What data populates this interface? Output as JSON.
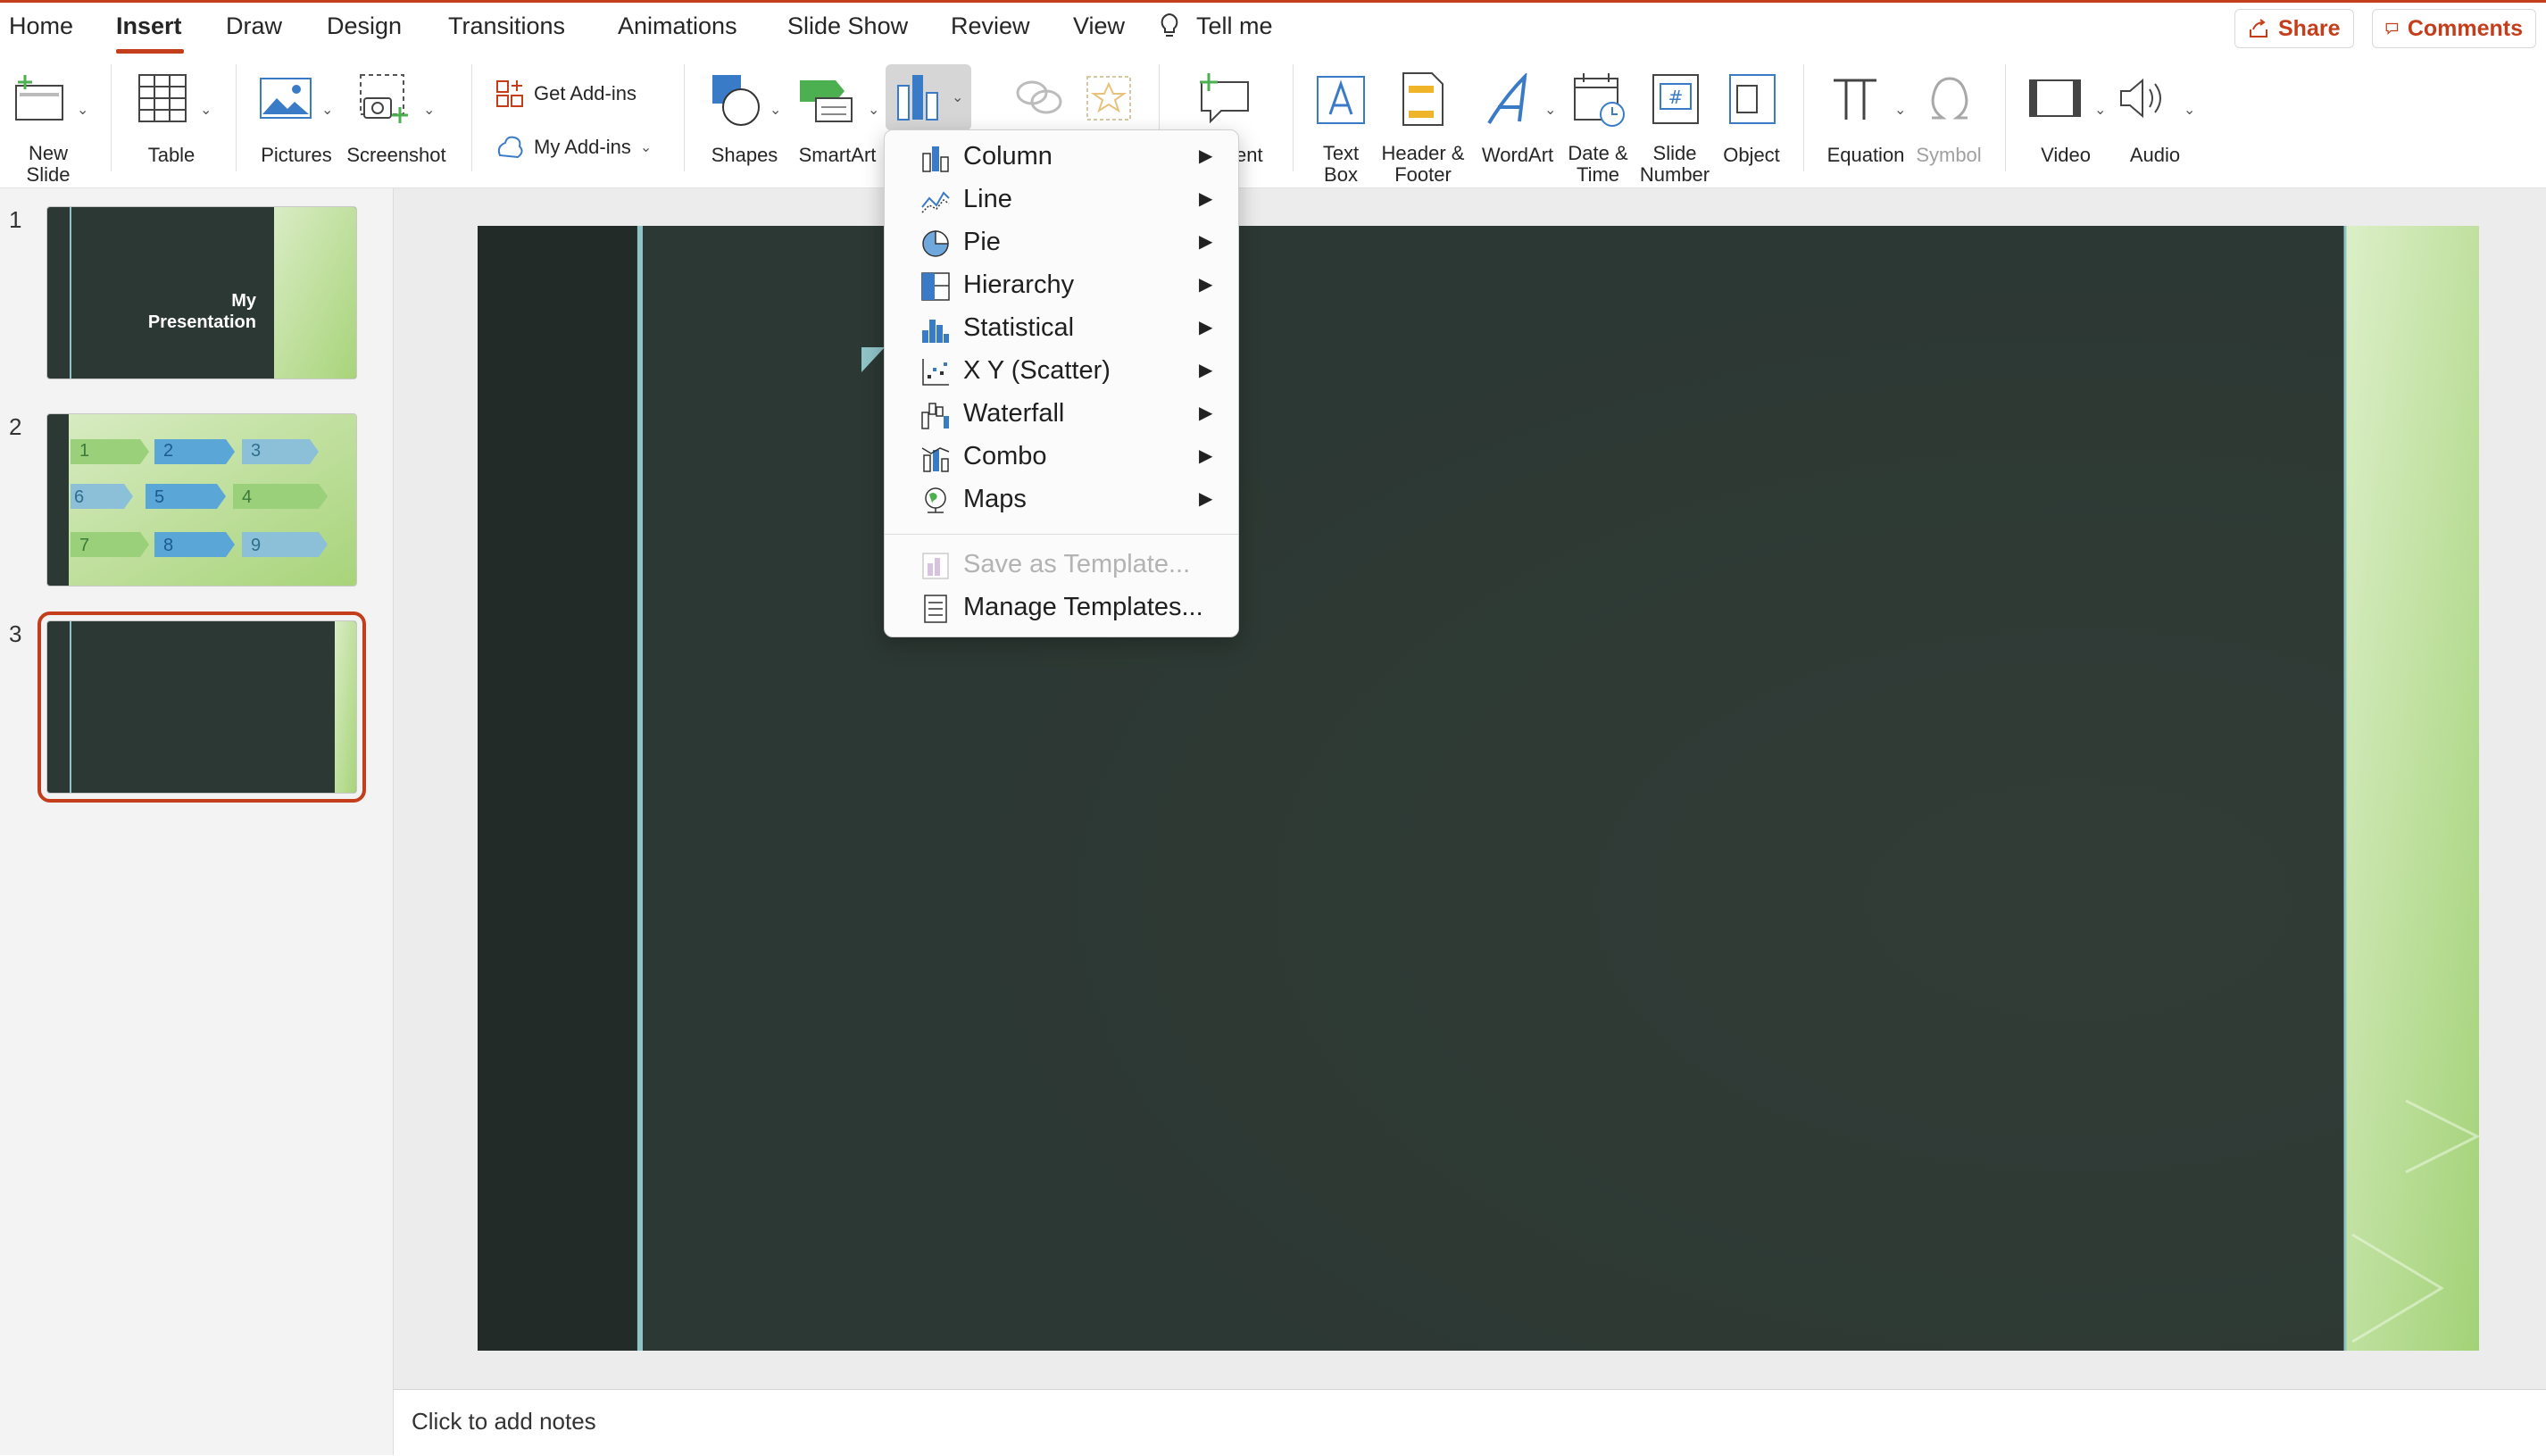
{
  "tabs": [
    "Home",
    "Insert",
    "Draw",
    "Design",
    "Transitions",
    "Animations",
    "Slide Show",
    "Review",
    "View"
  ],
  "active_tab": "Insert",
  "tellme": "Tell me",
  "share_label": "Share",
  "comments_label": "Comments",
  "ribbon": {
    "new_slide": "New\nSlide",
    "table": "Table",
    "pictures": "Pictures",
    "screenshot": "Screenshot",
    "get_addins": "Get Add-ins",
    "my_addins": "My Add-ins",
    "shapes": "Shapes",
    "smartart": "SmartArt",
    "comment_partial": "ent",
    "text_box": "Text\nBox",
    "header_footer": "Header &\nFooter",
    "wordart": "WordArt",
    "date_time": "Date &\nTime",
    "slide_number": "Slide\nNumber",
    "object": "Object",
    "equation": "Equation",
    "symbol": "Symbol",
    "video": "Video",
    "audio": "Audio"
  },
  "slides": [
    {
      "number": "1",
      "title_line1": "My",
      "title_line2": "Presentation"
    },
    {
      "number": "2",
      "cells": [
        "1",
        "2",
        "3",
        "6",
        "5",
        "4",
        "7",
        "8",
        "9"
      ]
    },
    {
      "number": "3"
    }
  ],
  "chart_menu": {
    "items": [
      {
        "label": "Column",
        "icon": "column-chart-icon"
      },
      {
        "label": "Line",
        "icon": "line-chart-icon"
      },
      {
        "label": "Pie",
        "icon": "pie-chart-icon"
      },
      {
        "label": "Hierarchy",
        "icon": "hierarchy-chart-icon"
      },
      {
        "label": "Statistical",
        "icon": "statistical-chart-icon"
      },
      {
        "label": "X Y (Scatter)",
        "icon": "scatter-chart-icon"
      },
      {
        "label": "Waterfall",
        "icon": "waterfall-chart-icon"
      },
      {
        "label": "Combo",
        "icon": "combo-chart-icon"
      },
      {
        "label": "Maps",
        "icon": "maps-chart-icon"
      }
    ],
    "save_template": "Save as Template...",
    "manage_templates": "Manage Templates..."
  },
  "notes_placeholder": "Click to add notes",
  "colors": {
    "accent": "#c43e1c",
    "slide_bg": "#2c3833",
    "slide_green": "#b9dc8a",
    "teal_line": "#8fc3c6"
  }
}
